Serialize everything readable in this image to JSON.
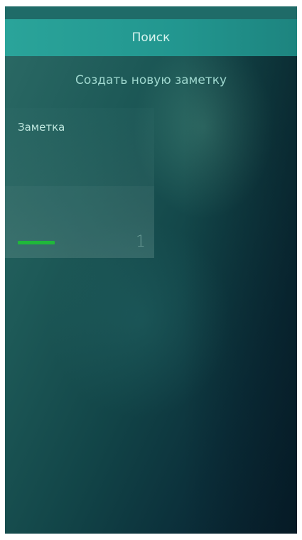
{
  "pulley_menu": {
    "search_label": "Поиск",
    "create_note_label": "Создать новую заметку"
  },
  "notes": [
    {
      "title": "Заметка",
      "index": "1",
      "color": "#1fb83a"
    }
  ]
}
